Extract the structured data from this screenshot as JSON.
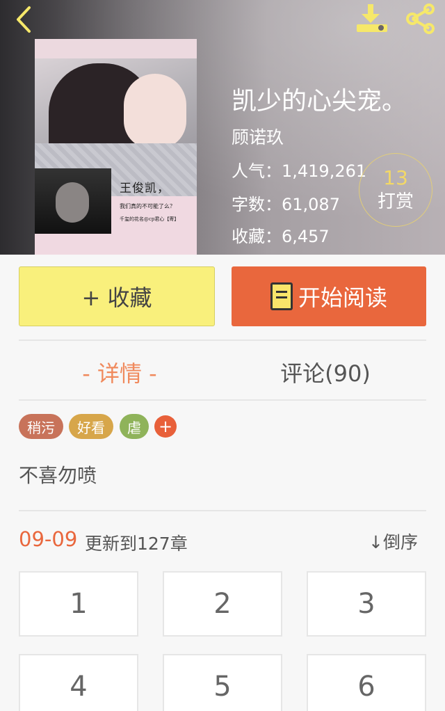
{
  "book": {
    "title": "凯少的心尖宠。",
    "author": "顾诺玖",
    "popularity": "人气：1,419,261",
    "word_count": "字数：61,087",
    "favorites": "收藏：6,457",
    "cover_text": {
      "line1": "王俊凯，",
      "line2": "我们真的不可能了么？",
      "line3": "千玺的花名@cp君心【寄】"
    }
  },
  "reward": {
    "count": "13",
    "label": "打赏"
  },
  "actions": {
    "favorite_label": "+ 收藏",
    "read_label": "开始阅读"
  },
  "tabs": {
    "detail": "- 详情 -",
    "comments": "评论(90)"
  },
  "tags": [
    {
      "label": "稍污",
      "color": "#c8735a"
    },
    {
      "label": "好看",
      "color": "#d7a64a"
    },
    {
      "label": "虐",
      "color": "#8fb35a"
    }
  ],
  "tag_add_label": "+",
  "summary": "不喜勿喷",
  "update": {
    "date": "09-09",
    "text": "更新到127章",
    "sort_label": "↓倒序"
  },
  "chapters": [
    "1",
    "2",
    "3",
    "4",
    "5",
    "6"
  ],
  "icons": {
    "back": "chevron-left-icon",
    "download": "download-icon",
    "share": "share-icon",
    "book": "book-icon"
  },
  "colors": {
    "accent": "#e9673d",
    "favorite_button": "#f9f07c",
    "reward_gold": "#f3d866",
    "icon_yellow": "#f6e86a"
  }
}
